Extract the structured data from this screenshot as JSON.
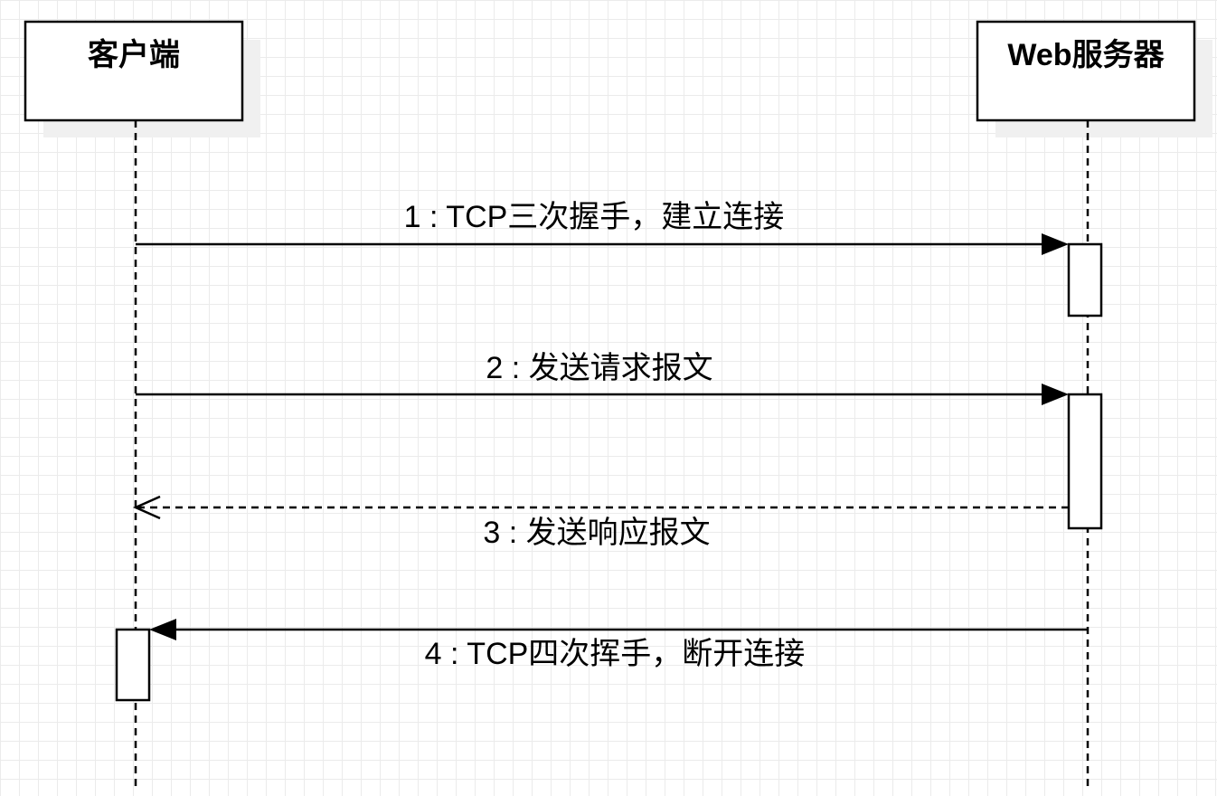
{
  "participants": {
    "client": {
      "name": "客户端"
    },
    "server": {
      "name": "Web服务器"
    }
  },
  "messages": [
    {
      "label": "1 : TCP三次握手，建立连接",
      "from": "client",
      "to": "server",
      "style": "solid"
    },
    {
      "label": "2 : 发送请求报文",
      "from": "client",
      "to": "server",
      "style": "solid"
    },
    {
      "label": "3 : 发送响应报文",
      "from": "server",
      "to": "client",
      "style": "dashed"
    },
    {
      "label": "4 : TCP四次挥手，断开连接",
      "from": "server",
      "to": "client",
      "style": "solid"
    }
  ]
}
